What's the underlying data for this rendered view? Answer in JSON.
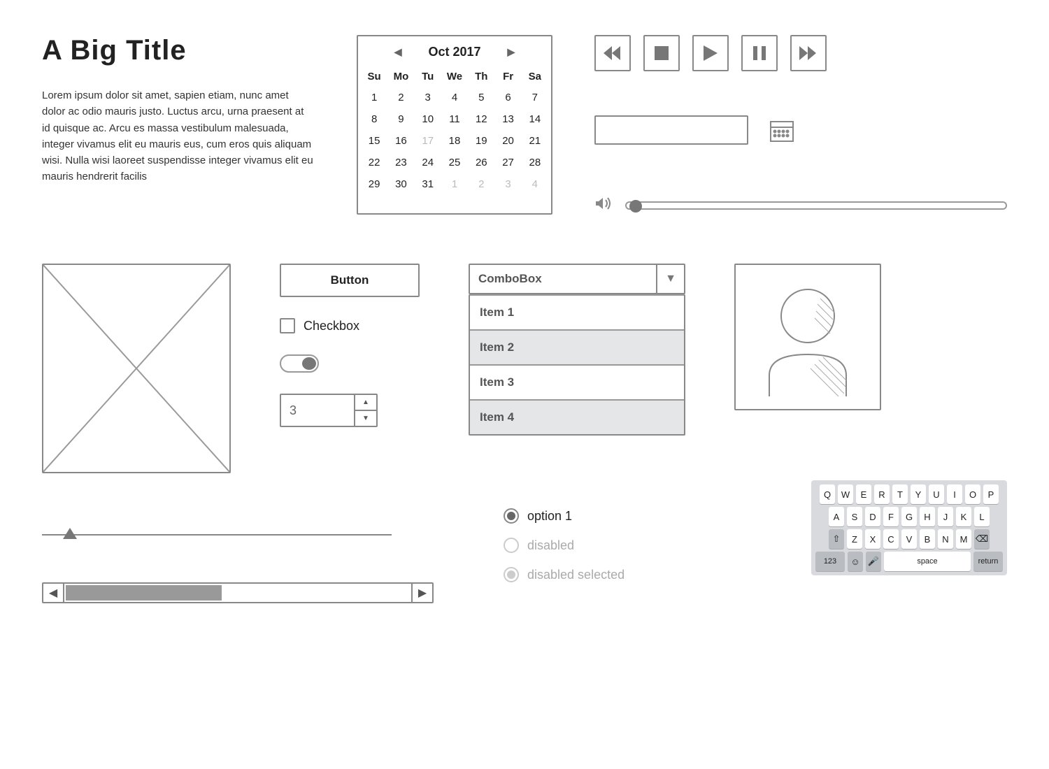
{
  "title": "A Big Title",
  "lorem": "Lorem ipsum dolor sit amet, sapien etiam, nunc amet dolor ac odio mauris justo. Luctus arcu, urna praesent at id quisque ac. Arcu es massa vestibulum malesuada, integer vivamus elit eu mauris eus, cum eros quis aliquam wisi. Nulla wisi laoreet suspendisse integer vivamus elit eu mauris hendrerit facilis",
  "calendar": {
    "month_label": "Oct 2017",
    "dow": [
      "Su",
      "Mo",
      "Tu",
      "We",
      "Th",
      "Fr",
      "Sa"
    ],
    "days": [
      {
        "n": "1"
      },
      {
        "n": "2"
      },
      {
        "n": "3"
      },
      {
        "n": "4"
      },
      {
        "n": "5"
      },
      {
        "n": "6"
      },
      {
        "n": "7"
      },
      {
        "n": "8"
      },
      {
        "n": "9"
      },
      {
        "n": "10"
      },
      {
        "n": "11"
      },
      {
        "n": "12"
      },
      {
        "n": "13"
      },
      {
        "n": "14"
      },
      {
        "n": "15"
      },
      {
        "n": "16"
      },
      {
        "n": "17",
        "dim": true
      },
      {
        "n": "18"
      },
      {
        "n": "19"
      },
      {
        "n": "20"
      },
      {
        "n": "21"
      },
      {
        "n": "22"
      },
      {
        "n": "23"
      },
      {
        "n": "24"
      },
      {
        "n": "25"
      },
      {
        "n": "26"
      },
      {
        "n": "27"
      },
      {
        "n": "28"
      },
      {
        "n": "29"
      },
      {
        "n": "30"
      },
      {
        "n": "31"
      },
      {
        "n": "1",
        "dim": true
      },
      {
        "n": "2",
        "dim": true
      },
      {
        "n": "3",
        "dim": true
      },
      {
        "n": "4",
        "dim": true
      }
    ]
  },
  "button_label": "Button",
  "checkbox_label": "Checkbox",
  "stepper_value": "3",
  "combo": {
    "label": "ComboBox",
    "items": [
      "Item 1",
      "Item 2",
      "Item 3",
      "Item 4"
    ]
  },
  "radios": {
    "opt1": "option 1",
    "opt2": "disabled",
    "opt3": "disabled selected"
  },
  "keyboard": {
    "row1": [
      "Q",
      "W",
      "E",
      "R",
      "T",
      "Y",
      "U",
      "I",
      "O",
      "P"
    ],
    "row2": [
      "A",
      "S",
      "D",
      "F",
      "G",
      "H",
      "J",
      "K",
      "L"
    ],
    "row3": [
      "Z",
      "X",
      "C",
      "V",
      "B",
      "N",
      "M"
    ],
    "fn": {
      "num": "123",
      "space": "space",
      "ret": "return"
    }
  }
}
